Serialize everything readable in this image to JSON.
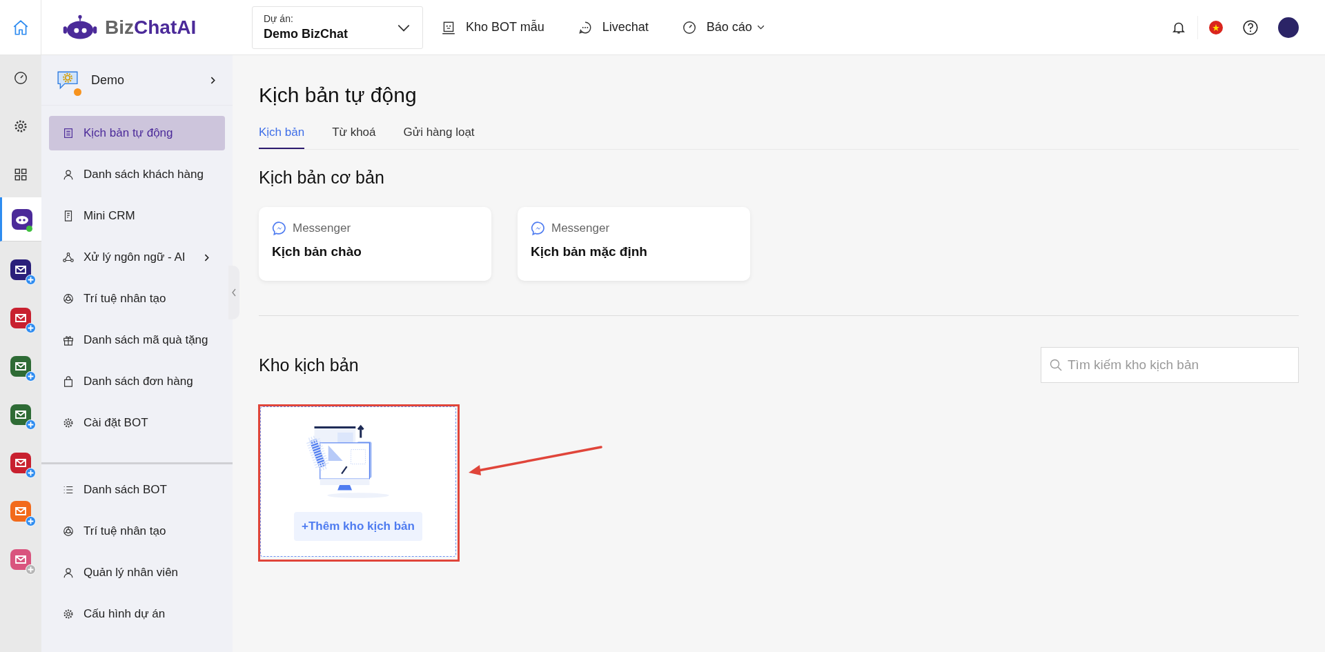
{
  "topbar": {
    "logo": {
      "part_1": "Biz",
      "part_2": "ChatAI"
    },
    "project": {
      "label": "Dự án:",
      "value": "Demo BizChat"
    },
    "nav": [
      {
        "label": "Kho BOT mẫu",
        "kind": "link"
      },
      {
        "label": "Livechat",
        "kind": "link"
      },
      {
        "label": "Báo cáo",
        "kind": "dropdown"
      }
    ]
  },
  "rail": {
    "tools": [
      {
        "selected": false
      },
      {
        "selected": false
      },
      {
        "selected": false
      }
    ],
    "active_app": {
      "selected": true,
      "online": true
    },
    "apps": [
      {
        "color": "#2a1f7a",
        "disabled": false
      },
      {
        "color": "#c8202f",
        "disabled": false
      },
      {
        "color": "#2e6b35",
        "disabled": false
      },
      {
        "color": "#2e6b35",
        "disabled": false
      },
      {
        "color": "#c8202f",
        "disabled": false
      },
      {
        "color": "#f26a1b",
        "disabled": false
      },
      {
        "color": "#d9547e",
        "disabled": true
      }
    ]
  },
  "sidebar": {
    "project": "Demo",
    "items": [
      {
        "label": "Kịch bản tự động",
        "selected": true,
        "has_submenu": false
      },
      {
        "label": "Danh sách khách hàng",
        "selected": false,
        "has_submenu": false
      },
      {
        "label": "Mini CRM",
        "selected": false,
        "has_submenu": false
      },
      {
        "label": "Xử lý ngôn ngữ - AI",
        "selected": false,
        "has_submenu": true
      },
      {
        "label": "Trí tuệ nhân tạo",
        "selected": false,
        "has_submenu": false
      },
      {
        "label": "Danh sách mã quà tặng",
        "selected": false,
        "has_submenu": false
      },
      {
        "label": "Danh sách đơn hàng",
        "selected": false,
        "has_submenu": false
      },
      {
        "label": "Cài đặt BOT",
        "selected": false,
        "has_submenu": false
      }
    ],
    "bottom_items": [
      {
        "label": "Danh sách BOT",
        "selected": false
      },
      {
        "label": "Trí tuệ nhân tạo",
        "selected": false
      },
      {
        "label": "Quản lý nhân viên",
        "selected": false
      },
      {
        "label": "Cấu hình dự án",
        "selected": false
      }
    ]
  },
  "page": {
    "title": "Kịch bản tự động",
    "tabs": [
      {
        "label": "Kịch bản",
        "selected": true
      },
      {
        "label": "Từ khoá",
        "selected": false
      },
      {
        "label": "Gửi hàng loạt",
        "selected": false
      }
    ],
    "basic_section": {
      "title": "Kịch bản cơ bản",
      "cards": [
        {
          "channel": "Messenger",
          "name": "Kịch bản chào"
        },
        {
          "channel": "Messenger",
          "name": "Kịch bản mặc định"
        }
      ]
    },
    "library_section": {
      "title": "Kho kịch bản",
      "search": {
        "placeholder": "Tìm kiếm kho kịch bản"
      },
      "add_button": "+Thêm kho kịch bản"
    }
  }
}
